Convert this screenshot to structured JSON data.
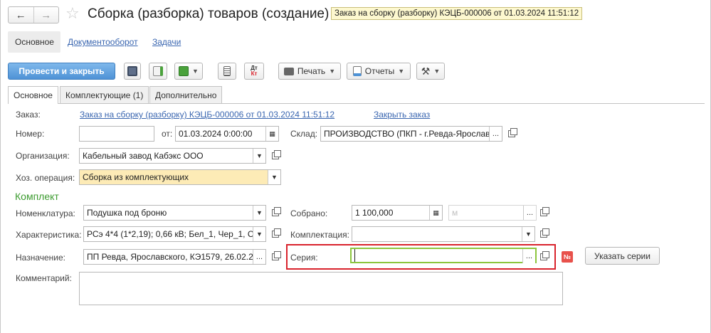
{
  "window": {
    "title": "Сборка (разборка) товаров (создание) *",
    "hint": "Заказ на сборку (разборку) КЭЦБ-000006 от 01.03.2024 11:51:12"
  },
  "top_tabs": [
    {
      "label": "Основное"
    },
    {
      "label": "Документооборот"
    },
    {
      "label": "Задачи"
    }
  ],
  "toolbar": {
    "post_close_label": "Провести и закрыть",
    "print_label": "Печать",
    "reports_label": "Отчеты",
    "dtkt_top": "Дт",
    "dtkt_bottom": "Кт"
  },
  "form_tabs": [
    {
      "label": "Основное"
    },
    {
      "label": "Комплектующие (1)"
    },
    {
      "label": "Дополнительно"
    }
  ],
  "form": {
    "order_label": "Заказ:",
    "order_link": "Заказ на сборку (разборку) КЭЦБ-000006 от 01.03.2024 11:51:12",
    "close_order_link": "Закрыть заказ",
    "number_label": "Номер:",
    "number_value": "",
    "date_label": "от:",
    "date_value": "01.03.2024  0:00:00",
    "warehouse_label": "Склад:",
    "warehouse_value": "ПРОИЗВОДСТВО (ПКП - г.Ревда-Ярославского",
    "org_label": "Организация:",
    "org_value": "Кабельный завод Кабэкс ООО",
    "operation_label": "Хоз. операция:",
    "operation_value": "Сборка из комплектующих",
    "kit_section": "Комплект",
    "nomenclature_label": "Номенклатура:",
    "nomenclature_value": "Подушка под броню",
    "assembled_label": "Собрано:",
    "assembled_value": "1 100,000",
    "unit_placeholder": "м",
    "characteristic_label": "Характеристика:",
    "characteristic_value": "РСэ 4*4 (1*2,19); 0,66 кВ; Бел_1, Чер_1, С",
    "kitting_label": "Комплектация:",
    "kitting_value": "",
    "purpose_label": "Назначение:",
    "purpose_value": "ПП Ревда, Ярославского, КЭ1579, 26.02.2",
    "series_label": "Серия:",
    "series_value": "",
    "series_badge": "№",
    "specify_series_button": "Указать серии",
    "comment_label": "Комментарий:",
    "comment_value": ""
  }
}
